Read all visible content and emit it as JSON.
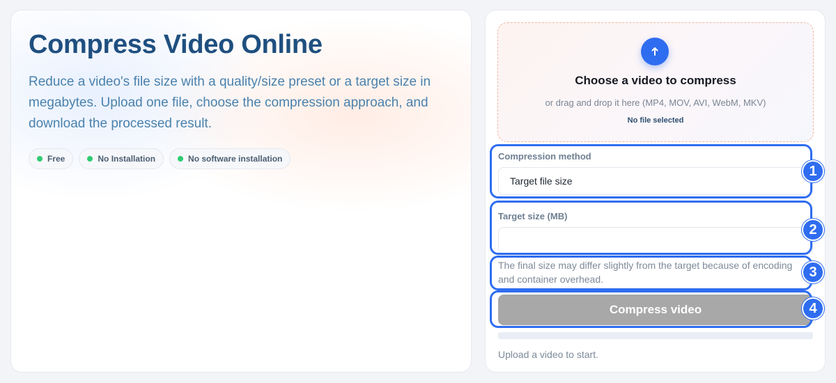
{
  "hero": {
    "title": "Compress Video Online",
    "description": "Reduce a video's file size with a quality/size preset or a target size in megabytes. Upload one file, choose the compression approach, and download the processed result.",
    "badges": [
      {
        "label": "Free"
      },
      {
        "label": "No Installation"
      },
      {
        "label": "No software installation"
      }
    ]
  },
  "upload": {
    "title": "Choose a video to compress",
    "subtitle": "or drag and drop it here (MP4, MOV, AVI, WebM, MKV)",
    "status": "No file selected",
    "icon": "arrow-up-icon"
  },
  "form": {
    "method_label": "Compression method",
    "method_value": "Target file size",
    "target_label": "Target size (MB)",
    "target_value": "",
    "target_placeholder": "",
    "helper": "The final size may differ slightly from the target because of encoding and container overhead.",
    "compress_label": "Compress video",
    "progress_percent": 0,
    "status": "Upload a video to start."
  },
  "annotations": [
    {
      "number": "1"
    },
    {
      "number": "2"
    },
    {
      "number": "3"
    },
    {
      "number": "4"
    }
  ],
  "colors": {
    "accent": "#2f6df0",
    "title": "#1f4f7f",
    "description": "#4a82ad",
    "badge_dot": "#2ecc71",
    "button_disabled": "#a8a8a8",
    "dropzone_border": "#f2b8a0"
  }
}
